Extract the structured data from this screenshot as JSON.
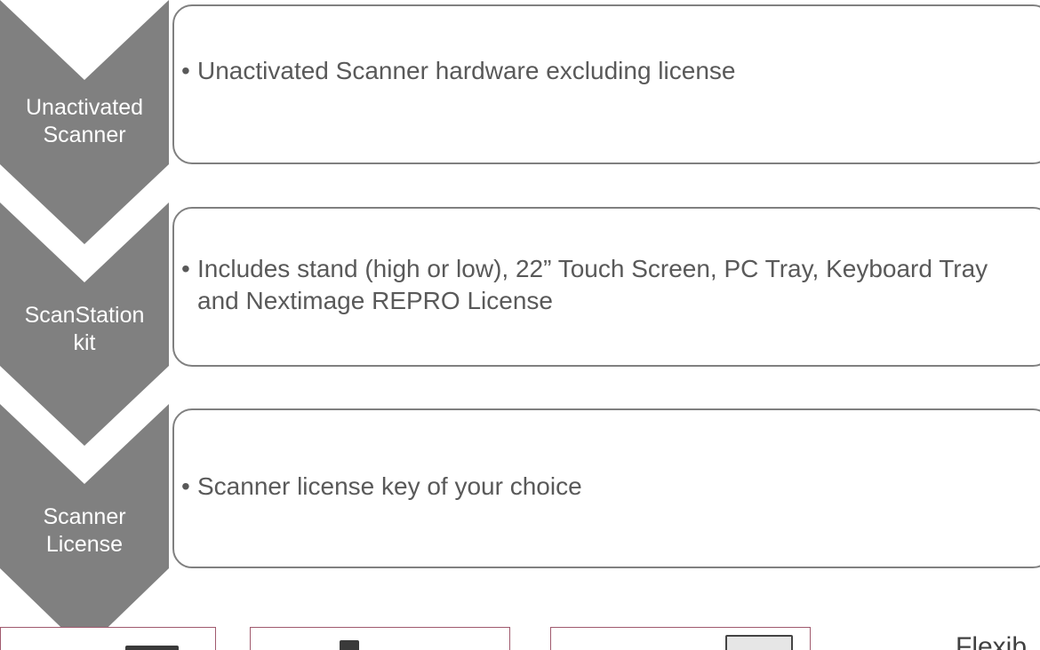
{
  "steps": [
    {
      "label": "Unactivated\nScanner",
      "bullets": [
        "Unactivated Scanner hardware excluding license"
      ]
    },
    {
      "label": "ScanStation\nkit",
      "bullets": [
        "Includes stand (high or low), 22” Touch Screen, PC Tray, Keyboard Tray and Nextimage REPRO License"
      ]
    },
    {
      "label": "Scanner\nLicense",
      "bullets": [
        "Scanner license key of your choice"
      ]
    }
  ],
  "bullet_symbol": "•",
  "cut_text": "Flexib",
  "colors": {
    "chevron": "#808080",
    "box_border": "#808080",
    "text": "#595959",
    "thumb_border": "#a05a6e"
  }
}
